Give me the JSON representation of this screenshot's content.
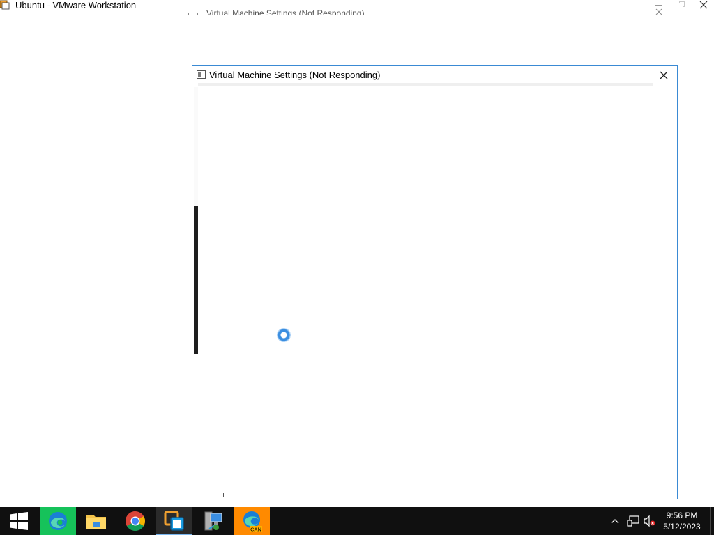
{
  "main_window": {
    "title": "Ubuntu - VMware Workstation",
    "controls": {
      "minimize": "—",
      "maximize": "▫",
      "close": "✕"
    }
  },
  "ghost_window": {
    "title": "Virtual Machine Settings (Not Responding)"
  },
  "dialog": {
    "title": "Virtual Machine Settings (Not Responding)",
    "close": "✕"
  },
  "taskbar": {
    "items": [
      {
        "name": "start",
        "icon": "windows-logo-icon"
      },
      {
        "name": "edge",
        "icon": "edge-icon"
      },
      {
        "name": "file-explorer",
        "icon": "folder-icon"
      },
      {
        "name": "chrome",
        "icon": "chrome-icon"
      },
      {
        "name": "vmware",
        "icon": "vmware-icon"
      },
      {
        "name": "network-tool",
        "icon": "computer-network-icon"
      },
      {
        "name": "edge-canary",
        "icon": "edge-canary-icon",
        "badge": "CAN"
      }
    ],
    "tray": {
      "chevron": "^"
    },
    "clock": {
      "time": "9:56 PM",
      "date": "5/12/2023"
    }
  },
  "colors": {
    "dialog_border": "#3a8ad4",
    "taskbar": "#101010",
    "spinner": "#3b8ee0"
  }
}
